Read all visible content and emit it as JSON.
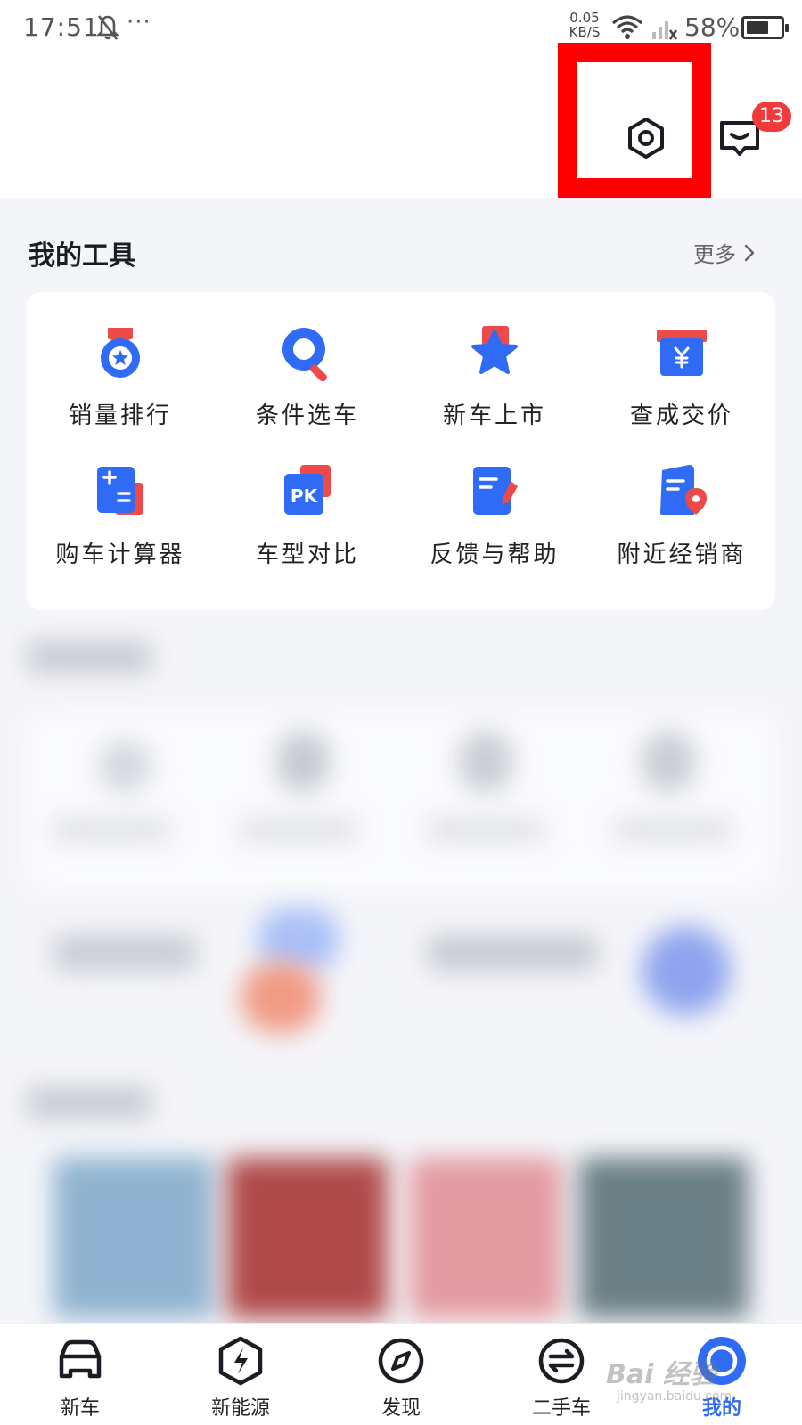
{
  "status_bar": {
    "time": "17:51",
    "more": "···",
    "speed_top": "0.05",
    "speed_bottom": "KB/S",
    "battery": "58%"
  },
  "header": {
    "message_badge": "13"
  },
  "tools": {
    "title": "我的工具",
    "more_label": "更多",
    "items": [
      {
        "label": "销量排行",
        "icon": "medal-icon"
      },
      {
        "label": "条件选车",
        "icon": "search-icon"
      },
      {
        "label": "新车上市",
        "icon": "star-icon"
      },
      {
        "label": "查成交价",
        "icon": "price-tag-icon"
      },
      {
        "label": "购车计算器",
        "icon": "calculator-icon"
      },
      {
        "label": "车型对比",
        "icon": "pk-compare-icon"
      },
      {
        "label": "反馈与帮助",
        "icon": "feedback-icon"
      },
      {
        "label": "附近经销商",
        "icon": "dealer-location-icon"
      }
    ]
  },
  "bottom_nav": {
    "items": [
      {
        "label": "新车",
        "icon": "car-icon"
      },
      {
        "label": "新能源",
        "icon": "lightning-icon"
      },
      {
        "label": "发现",
        "icon": "compass-icon"
      },
      {
        "label": "二手车",
        "icon": "exchange-icon"
      },
      {
        "label": "我的",
        "icon": "profile-icon"
      }
    ],
    "active": "我的"
  },
  "watermark": {
    "brand": "Bai 经验",
    "url": "jingyan.baidu.com"
  },
  "colors": {
    "accent": "#2f6bf5",
    "badge": "#f23a3a",
    "highlight": "#ff0000",
    "icon_red": "#ee4a4a"
  }
}
